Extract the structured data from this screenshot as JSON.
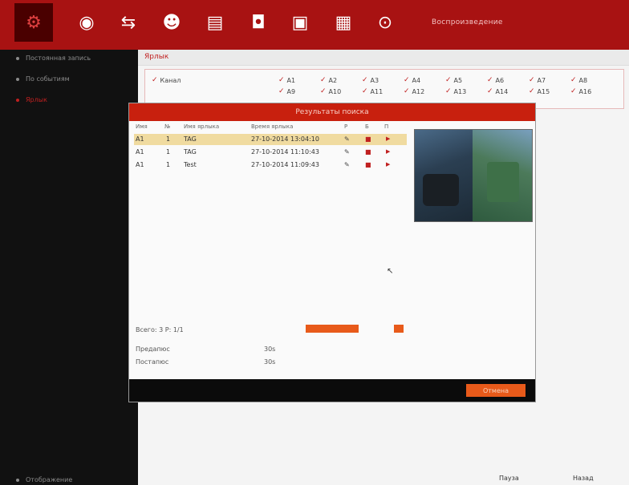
{
  "toolbar": {
    "title": "Воспроизведение",
    "buttons": [
      {
        "name": "config",
        "icon": "⚙"
      },
      {
        "name": "camera",
        "icon": "◉"
      },
      {
        "name": "network",
        "icon": "⇆"
      },
      {
        "name": "user",
        "icon": "☻"
      },
      {
        "name": "storage",
        "icon": "▤"
      },
      {
        "name": "cctv",
        "icon": "◘"
      },
      {
        "name": "search-record",
        "icon": "▣"
      },
      {
        "name": "export",
        "icon": "▦"
      },
      {
        "name": "shutdown",
        "icon": "⊙"
      }
    ]
  },
  "sidebar": {
    "items": [
      {
        "label": "Постоянная запись"
      },
      {
        "label": "По событиям"
      },
      {
        "label": "Ярлык"
      }
    ],
    "bottom": "Отображение"
  },
  "main": {
    "header": "Ярлык",
    "channel_label": "Канал",
    "channels_row1": [
      "A1",
      "A2",
      "A3",
      "A4",
      "A5",
      "A6",
      "A7",
      "A8"
    ],
    "channels_row2": [
      "A9",
      "A10",
      "A11",
      "A12",
      "A13",
      "A14",
      "A15",
      "A16"
    ]
  },
  "dialog": {
    "title": "Результаты поиска",
    "columns": [
      "Имя",
      "№",
      "Имя ярлыка",
      "Время ярлыка",
      "Р",
      "Б",
      "П"
    ],
    "rows": [
      {
        "channel": "A1",
        "no": "1",
        "tag": "TAG",
        "time": "27-10-2014 13:04:10"
      },
      {
        "channel": "A1",
        "no": "1",
        "tag": "TAG",
        "time": "27-10-2014 11:10:43"
      },
      {
        "channel": "A1",
        "no": "1",
        "tag": "Test",
        "time": "27-10-2014 11:09:43"
      }
    ],
    "total": "Всего: 3  P: 1/1",
    "before_label": "Предапюс",
    "before_value": "30s",
    "after_label": "Постапюс",
    "after_value": "30s",
    "cancel": "Отмена"
  },
  "bottom_right": {
    "menu": "Пауза",
    "back": "Назад"
  }
}
